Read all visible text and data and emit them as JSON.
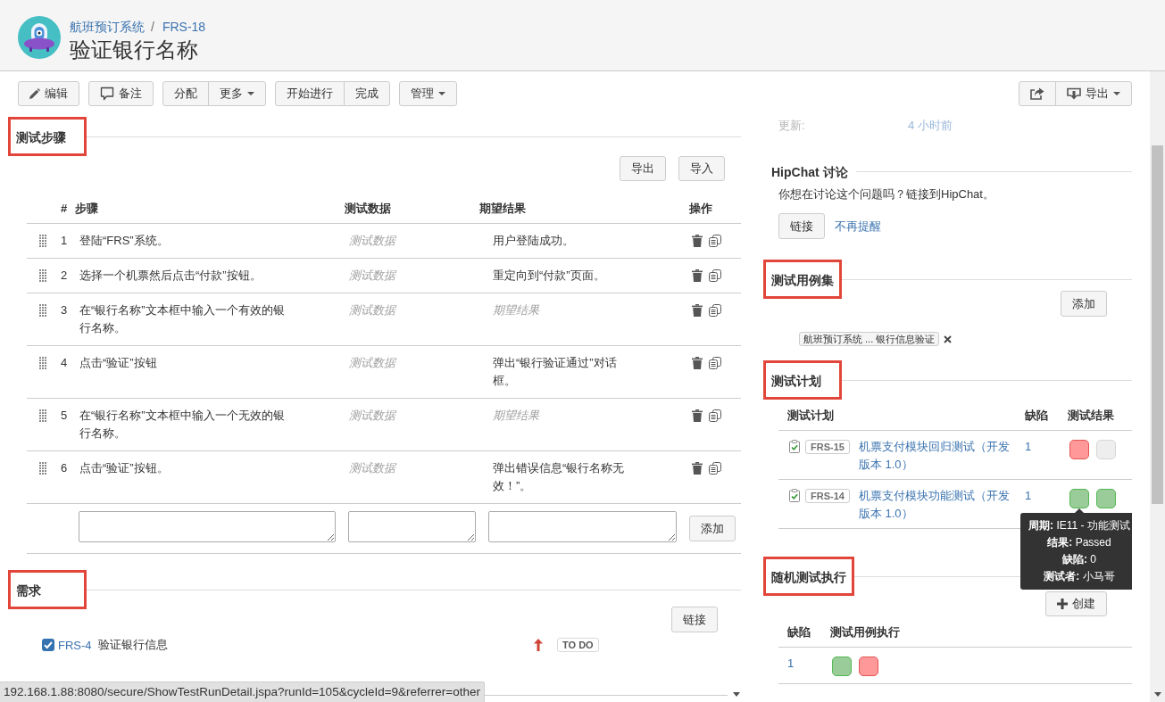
{
  "header": {
    "breadcrumbs": {
      "items": [
        "航班预订系统",
        "FRS-18"
      ],
      "separator": "/"
    },
    "title": "验证银行名称"
  },
  "toolbar": {
    "left": [
      {
        "buttons": [
          {
            "kind": "edit",
            "label": "编辑"
          }
        ]
      },
      {
        "buttons": [
          {
            "kind": "comment",
            "label": "备注"
          }
        ]
      },
      {
        "buttons": [
          {
            "kind": "plain",
            "label": "分配"
          },
          {
            "kind": "menu",
            "label": "更多"
          }
        ]
      },
      {
        "buttons": [
          {
            "kind": "plain",
            "label": "开始进行"
          },
          {
            "kind": "plain",
            "label": "完成"
          }
        ]
      },
      {
        "buttons": [
          {
            "kind": "menu",
            "label": "管理"
          }
        ]
      }
    ],
    "right": [
      {
        "buttons": [
          {
            "kind": "share"
          },
          {
            "kind": "export",
            "label": "导出"
          }
        ]
      }
    ]
  },
  "test_steps": {
    "heading": "测试步骤",
    "highlighted": true,
    "actions": [
      "导出",
      "导入"
    ],
    "columns": [
      "#",
      "步骤",
      "测试数据",
      "期望结果",
      "操作"
    ],
    "rows": [
      {
        "number": "1",
        "step": "登陆“FRS”系统。",
        "test_data": {
          "placeholder": "测试数据"
        },
        "expected": {
          "value": "用户登陆成功。"
        }
      },
      {
        "number": "2",
        "step": "选择一个机票然后点击“付款”按钮。",
        "test_data": {
          "placeholder": "测试数据"
        },
        "expected": {
          "value": "重定向到“付款”页面。"
        }
      },
      {
        "number": "3",
        "step": "在“银行名称”文本框中输入一个有效的银行名称。",
        "test_data": {
          "placeholder": "测试数据"
        },
        "expected": {
          "placeholder": "期望结果"
        }
      },
      {
        "number": "4",
        "step": "点击“验证”按钮",
        "test_data": {
          "placeholder": "测试数据"
        },
        "expected": {
          "value": "弹出“银行验证通过”对话框。"
        }
      },
      {
        "number": "5",
        "step": "在“银行名称”文本框中输入一个无效的银行名称。",
        "test_data": {
          "placeholder": "测试数据"
        },
        "expected": {
          "placeholder": "期望结果"
        }
      },
      {
        "number": "6",
        "step": "点击“验证”按钮。",
        "test_data": {
          "placeholder": "测试数据"
        },
        "expected": {
          "value": "弹出错误信息“银行名称无效！”。"
        }
      }
    ],
    "add_button": "添加"
  },
  "requirements": {
    "heading": "需求",
    "highlighted": true,
    "action": "链接",
    "items": [
      {
        "checked": true,
        "key": "FRS-4",
        "summary": "验证银行信息",
        "high_priority": true,
        "status": "TO DO"
      }
    ]
  },
  "side_panel": {
    "details": [
      {
        "label": "更新:",
        "value": "4 小时前"
      }
    ],
    "hipchat": {
      "heading": "HipChat 讨论",
      "highlighted": false,
      "message": "你想在讨论这个问题吗？链接到HipChat。",
      "button": "链接",
      "dismiss": "不再提醒"
    },
    "test_sets": {
      "heading": "测试用例集",
      "highlighted": true,
      "action": "添加",
      "tags": [
        "航班预订系统 ... 银行信息验证"
      ]
    },
    "test_plans": {
      "heading": "测试计划",
      "highlighted": true,
      "columns": [
        "测试计划",
        "缺陷",
        "测试结果"
      ],
      "rows": [
        {
          "key": "FRS-15",
          "name": "机票支付模块回归测试（开发版本 1.0）",
          "defects": "1",
          "results": [
            {
              "color": "#ff9999"
            },
            {
              "color": "#eeeeee"
            }
          ]
        },
        {
          "key": "FRS-14",
          "name": "机票支付模块功能测试（开发版本 1.0）",
          "defects": "1",
          "results": [
            {
              "color": "#99cc99",
              "tooltip": [
                "**周期:** IE11 - 功能测试",
                "**结果:** Passed",
                "**缺陷:** 0",
                "**测试者:** 小马哥"
              ]
            },
            {
              "color": "#99cc99"
            }
          ]
        }
      ]
    },
    "random_runs": {
      "heading": "随机测试执行",
      "highlighted": true,
      "action": "创建",
      "columns": [
        "缺陷",
        "测试用例执行"
      ],
      "rows": [
        {
          "defects": "1",
          "results": [
            {
              "color": "#99cc99"
            },
            {
              "color": "#ff9999"
            }
          ]
        }
      ]
    }
  },
  "status_bar": {
    "url": "192.168.1.88:8080/secure/ShowTestRunDetail.jspa?runId=105&cycleId=9&referrer=other"
  }
}
